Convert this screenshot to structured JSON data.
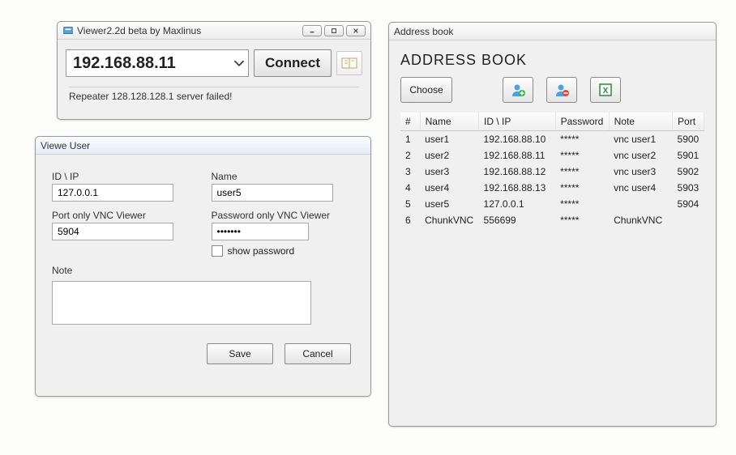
{
  "main": {
    "title": "Viewer2.2d beta by Maxlinus",
    "address": "192.168.88.11",
    "connect_label": "Connect",
    "status": "Repeater 128.128.128.1 server failed!"
  },
  "user": {
    "title": "Viewe User",
    "labels": {
      "id_ip": "ID \\ IP",
      "name": "Name",
      "port": "Port only VNC Viewer",
      "password": "Password only VNC Viewer",
      "show_password": "show password",
      "note": "Note"
    },
    "values": {
      "id_ip": "127.0.0.1",
      "name": "user5",
      "port": "5904",
      "password": "•••••••",
      "note": ""
    },
    "buttons": {
      "save": "Save",
      "cancel": "Cancel"
    }
  },
  "book": {
    "title": "Address book",
    "heading": "ADDRESS BOOK",
    "choose_label": "Choose",
    "columns": {
      "n": "#",
      "name": "Name",
      "idip": "ID \\ IP",
      "password": "Password",
      "note": "Note",
      "port": "Port"
    },
    "rows": [
      {
        "n": "1",
        "name": "user1",
        "idip": "192.168.88.10",
        "password": "*****",
        "note": "vnc user1",
        "port": "5900"
      },
      {
        "n": "2",
        "name": "user2",
        "idip": "192.168.88.11",
        "password": "*****",
        "note": "vnc user2",
        "port": "5901"
      },
      {
        "n": "3",
        "name": "user3",
        "idip": "192.168.88.12",
        "password": "*****",
        "note": "vnc user3",
        "port": "5902"
      },
      {
        "n": "4",
        "name": "user4",
        "idip": "192.168.88.13",
        "password": "*****",
        "note": "vnc user4",
        "port": "5903"
      },
      {
        "n": "5",
        "name": "user5",
        "idip": "127.0.0.1",
        "password": "*****",
        "note": "",
        "port": "5904"
      },
      {
        "n": "6",
        "name": "ChunkVNC",
        "idip": "556699",
        "password": "*****",
        "note": "ChunkVNC",
        "port": ""
      }
    ]
  }
}
